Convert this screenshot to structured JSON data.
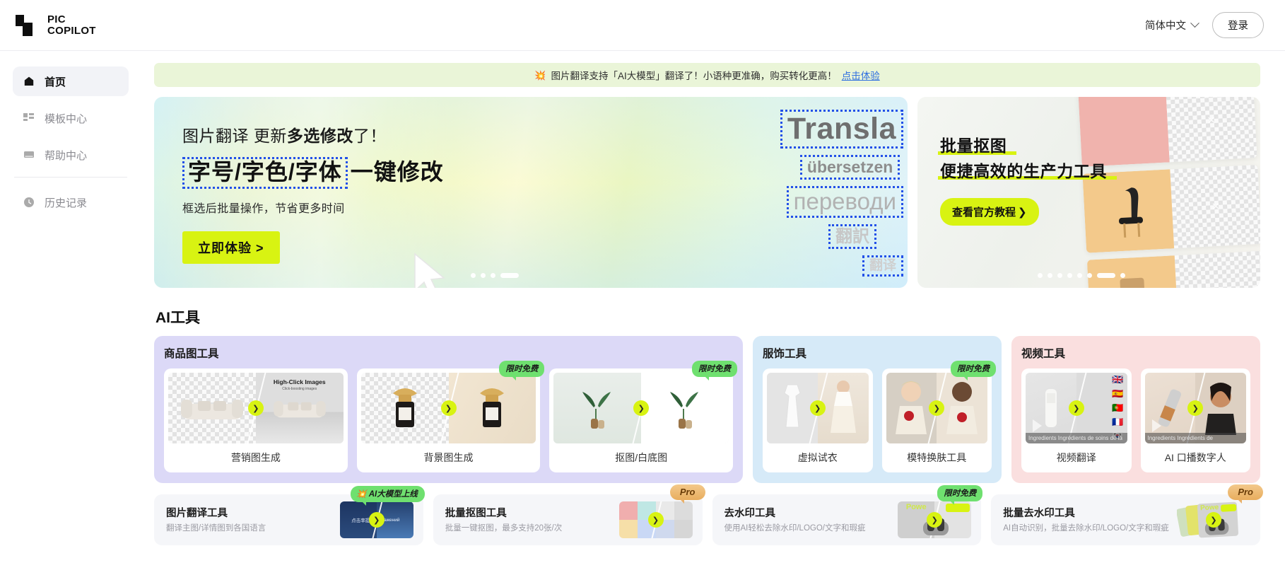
{
  "brand": {
    "line1": "PIC",
    "line2": "COPILOT"
  },
  "header": {
    "language": "简体中文",
    "login": "登录"
  },
  "notice": {
    "icon": "💥",
    "text": "图片翻译支持「AI大模型」翻译了！小语种更准确，购买转化更高！",
    "link": "点击体验"
  },
  "sidebar": {
    "items": [
      {
        "label": "首页",
        "icon": "home-icon",
        "active": true
      },
      {
        "label": "模板中心",
        "icon": "grid-icon",
        "active": false
      },
      {
        "label": "帮助中心",
        "icon": "book-icon",
        "active": false
      },
      {
        "label": "历史记录",
        "icon": "clock-icon",
        "active": false
      }
    ]
  },
  "hero_left": {
    "line1_a": "图片翻译 更新",
    "line1_b": "多选修改",
    "line1_c": "了！",
    "boxed": "字号/字色/字体",
    "line2_rest": "一键修改",
    "subtitle": "框选后批量操作，节省更多时间",
    "cta": "立即体验 >",
    "words": [
      "Transla",
      "übersetzen",
      "переводи",
      "翻訳",
      "翻译"
    ],
    "dots_total": 4,
    "dots_active": 4
  },
  "hero_right": {
    "title_line1": "批量抠图",
    "title_line2": "便捷高效的生产力工具",
    "cta": "查看官方教程",
    "cta_chevron": "❯",
    "dots_total": 8,
    "dots_active": 7
  },
  "section": {
    "title": "AI工具"
  },
  "groups": [
    {
      "title": "商品图工具",
      "theme": "g-purple",
      "cards": [
        {
          "label": "营销图生成",
          "badge": "",
          "overlay_title": "High-Click Images",
          "overlay_sub": "Click-boosting images"
        },
        {
          "label": "背景图生成",
          "badge": "限时免费",
          "overlay_title": "",
          "overlay_sub": ""
        },
        {
          "label": "抠图/白底图",
          "badge": "限时免费",
          "overlay_title": "",
          "overlay_sub": ""
        }
      ]
    },
    {
      "title": "服饰工具",
      "theme": "g-blue",
      "cards": [
        {
          "label": "虚拟试衣",
          "badge": "",
          "overlay_title": "",
          "overlay_sub": ""
        },
        {
          "label": "模特换肤工具",
          "badge": "限时免费",
          "overlay_title": "",
          "overlay_sub": ""
        }
      ]
    },
    {
      "title": "视频工具",
      "theme": "g-pink",
      "cards": [
        {
          "label": "视频翻译",
          "badge": "",
          "caption": "Ingredients Ingrédients de soins de la",
          "overlay_title": "",
          "overlay_sub": ""
        },
        {
          "label": "AI 口播数字人",
          "badge": "",
          "caption": "Ingredients Ingrédients de",
          "overlay_title": "",
          "overlay_sub": ""
        }
      ]
    }
  ],
  "tools": [
    {
      "title": "图片翻译工具",
      "desc": "翻译主图/详情图到各国语言",
      "badge": "AI大模型上线",
      "badge_type": "ai",
      "thumb_text_left": "点击率提升",
      "thumb_text_right": "бражений"
    },
    {
      "title": "批量抠图工具",
      "desc": "批量一键抠图，最多支持20张/次",
      "badge": "Pro",
      "badge_type": "pro",
      "thumb_text_left": "",
      "thumb_text_right": ""
    },
    {
      "title": "去水印工具",
      "desc": "使用AI轻松去除水印/LOGO/文字和瑕疵",
      "badge": "限时免费",
      "badge_type": "free",
      "thumb_text_left": "Powe",
      "thumb_text_right": ""
    },
    {
      "title": "批量去水印工具",
      "desc": "AI自动识别，批量去除水印/LOGO/文字和瑕疵",
      "badge": "Pro",
      "badge_type": "pro",
      "thumb_text_left": "Powe",
      "thumb_text_right": ""
    }
  ],
  "colors": {
    "accent_lime": "#d8f312",
    "badge_green": "#6fe06f",
    "badge_pro": "#e8ad5e",
    "link_blue": "#2f6fe0",
    "notice_bg": "#eaf5d8"
  }
}
